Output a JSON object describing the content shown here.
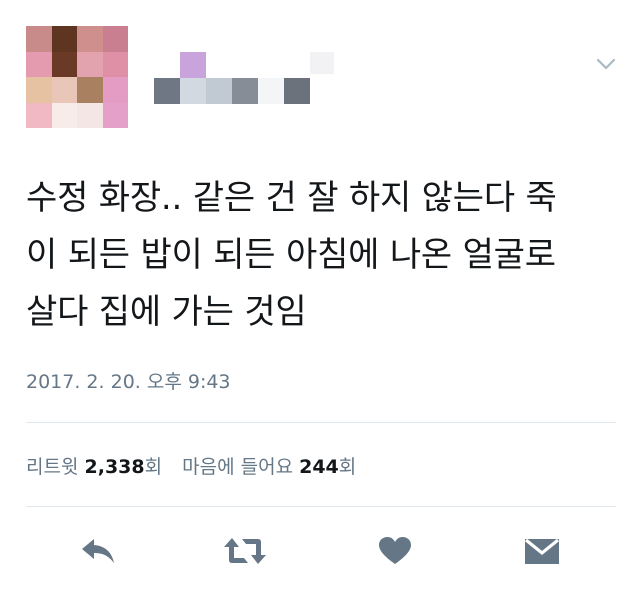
{
  "tweet": {
    "text_lines": [
      "수정 화장.. 같은 건 잘 하지 않는다 죽",
      "이 되든 밥이 되든 아침에 나온 얼굴로",
      "살다 집에 가는 것임"
    ],
    "timestamp": "2017. 2. 20. 오후 9:43"
  },
  "stats": {
    "retweet_label": "리트윗",
    "retweet_count": "2,338",
    "retweet_suffix": "회",
    "like_label": "마음에 들어요",
    "like_count": "244",
    "like_suffix": "회"
  },
  "icons": {
    "menu": "chevron-down-icon",
    "reply": "reply-icon",
    "retweet": "retweet-icon",
    "like": "heart-icon",
    "dm": "envelope-icon"
  },
  "colors": {
    "icon": "#657786",
    "text": "#14171a",
    "secondary": "#657786",
    "divider": "#e1e8ed"
  }
}
